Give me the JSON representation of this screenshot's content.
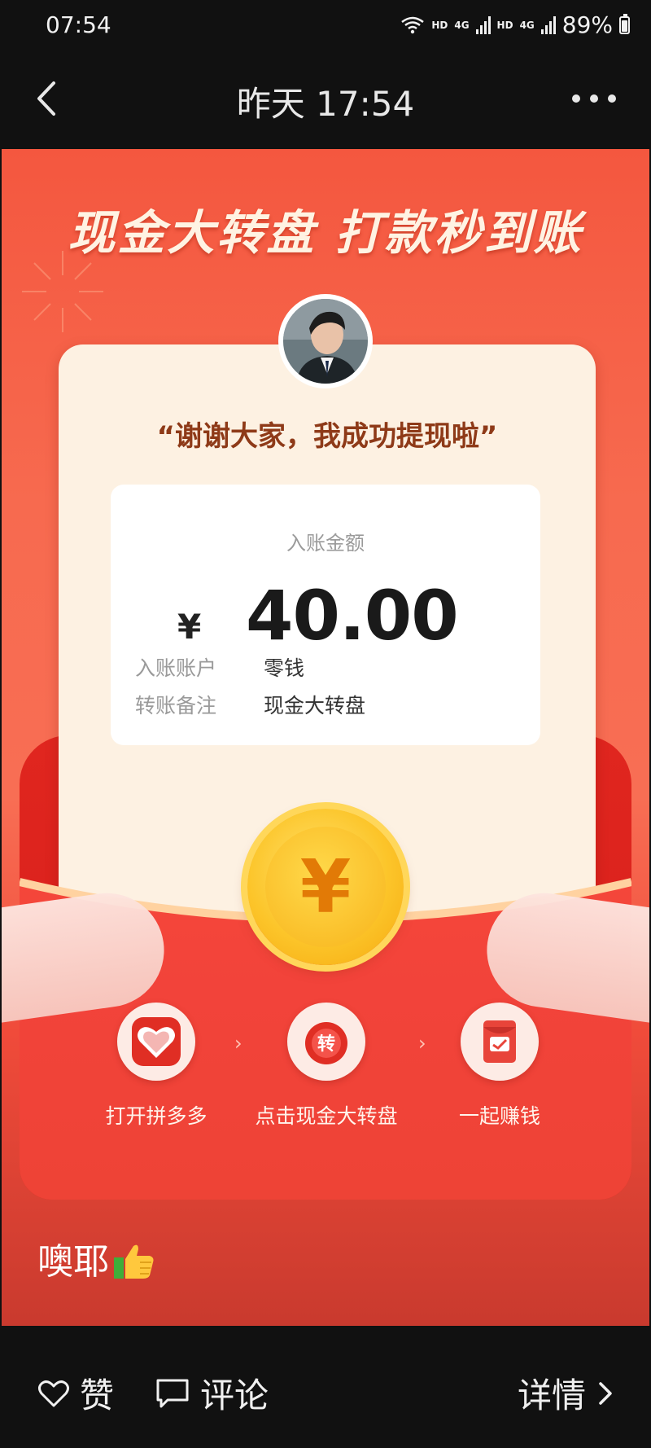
{
  "status_bar": {
    "time": "07:54",
    "hd1": "HD",
    "net1": "4G",
    "hd2": "HD",
    "net2": "4G",
    "battery": "89%"
  },
  "header": {
    "title": "昨天 17:54",
    "back_icon": "chevron-left-icon",
    "more_icon": "ellipsis-icon"
  },
  "poster": {
    "title": "现金大转盘 打款秒到账",
    "quote": "“谢谢大家，我成功提现啦”",
    "receipt": {
      "label": "入账金额",
      "currency": "¥",
      "amount": "40.00",
      "account_key": "入账账户",
      "account_value": "零钱",
      "note_key": "转账备注",
      "note_value": "现金大转盘"
    },
    "coin_symbol": "¥",
    "steps": [
      {
        "label": "打开拼多多",
        "icon": "pinduoduo-app-icon"
      },
      {
        "label": "点击现金大转盘",
        "icon": "turntable-icon",
        "icon_text": "转"
      },
      {
        "label": "一起赚钱",
        "icon": "red-envelope-icon"
      }
    ],
    "step_arrow": "›",
    "colors": {
      "accent_red": "#f4573f",
      "coin_gold": "#fcc52a",
      "quote_brown": "#8e3a18"
    }
  },
  "caption": {
    "text": "噢耶",
    "emoji_icon": "thumbs-up-icon"
  },
  "bottom_bar": {
    "like_label": "赞",
    "comment_label": "评论",
    "details_label": "详情"
  }
}
